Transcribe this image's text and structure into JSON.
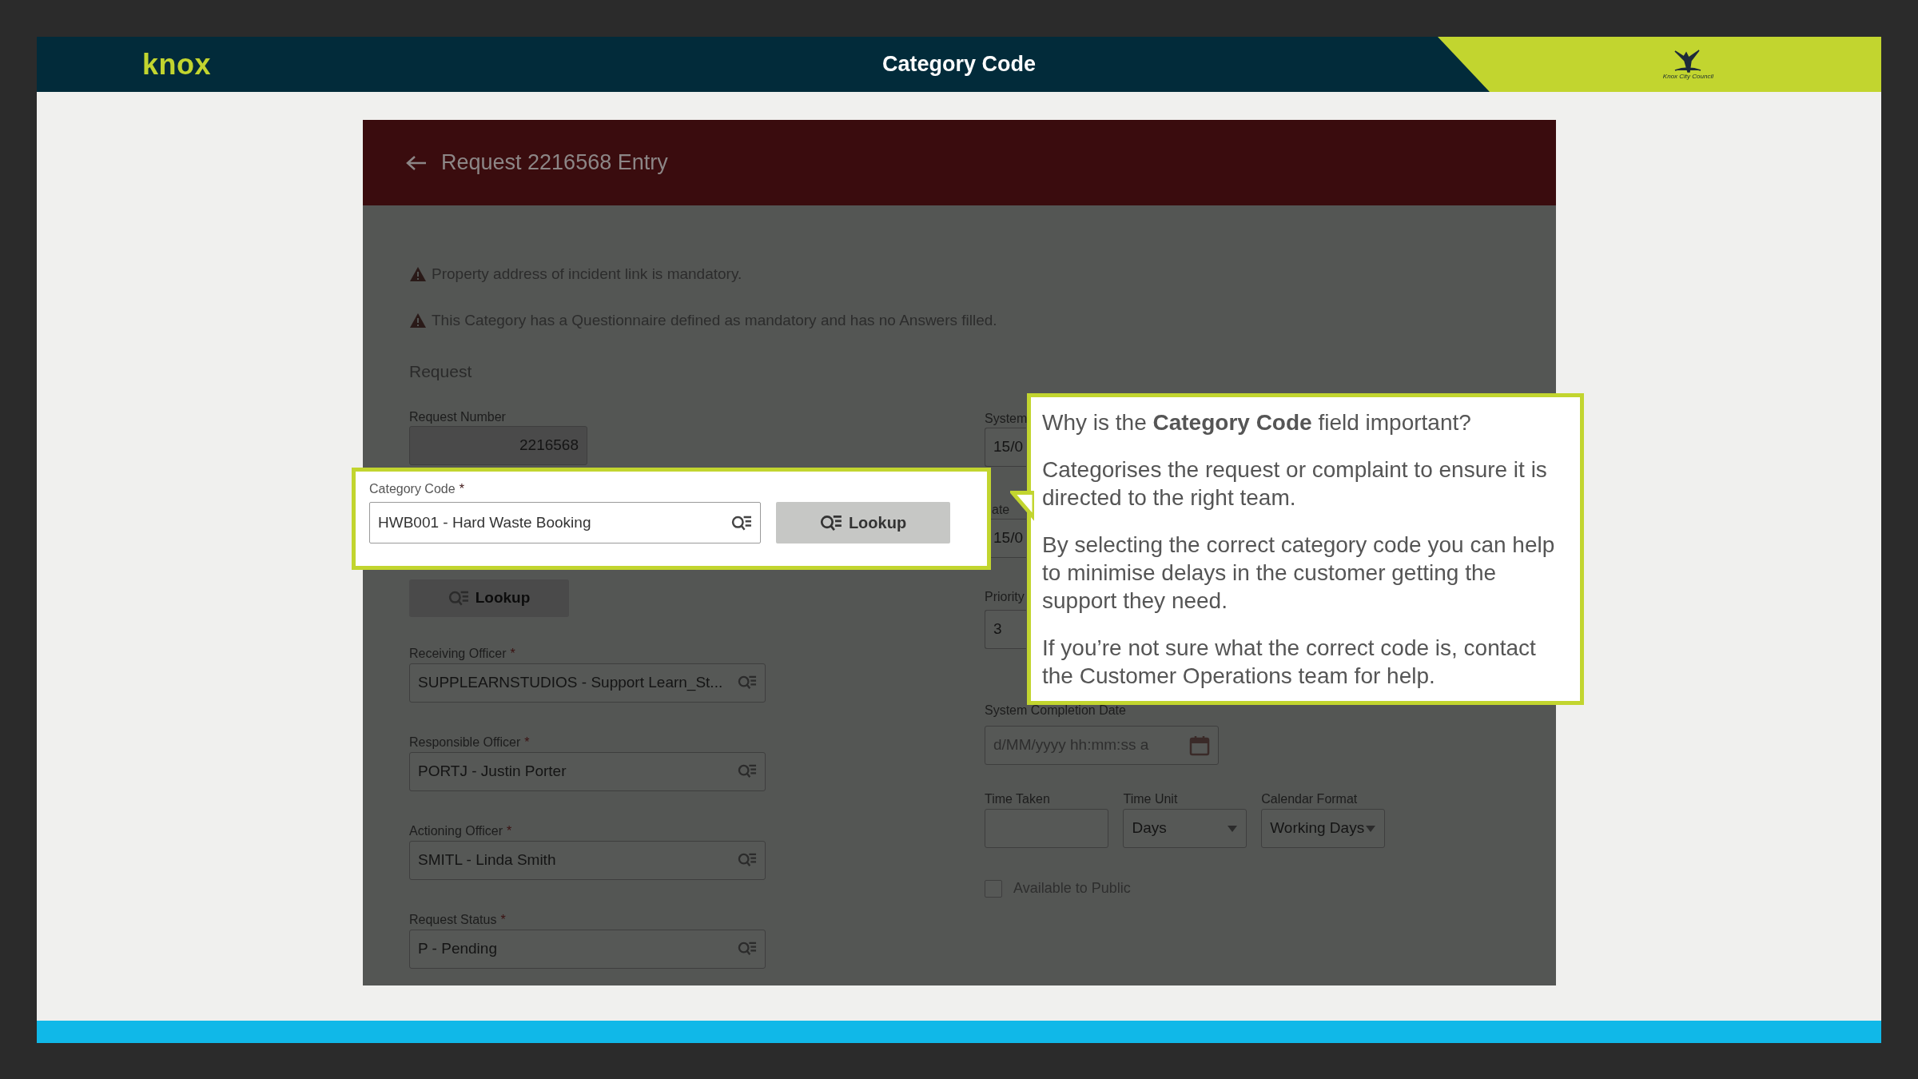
{
  "header": {
    "logo": "knox",
    "title": "Category Code",
    "emblem_caption": "Knox City Council"
  },
  "page": {
    "title": "Request 2216568 Entry"
  },
  "warnings": [
    "Property address of incident link is mandatory.",
    "This Category has a Questionnaire defined as mandatory and has no Answers filled."
  ],
  "section": "Request",
  "required_marker": "*",
  "request_number": {
    "label": "Request Number",
    "value": "2216568"
  },
  "lookup_button": "Lookup",
  "officer_fields": [
    {
      "label": "Receiving Officer",
      "required": true,
      "value": "SUPPLEARNSTUDIOS - Support Learn_St..."
    },
    {
      "label": "Responsible Officer",
      "required": true,
      "value": "PORTJ - Justin Porter"
    },
    {
      "label": "Actioning Officer",
      "required": true,
      "value": "SMITL - Linda Smith"
    },
    {
      "label": "Request Status",
      "required": true,
      "value": "P - Pending"
    }
  ],
  "right_fields": [
    {
      "label": "System",
      "value": "15/0"
    },
    {
      "label": "ate",
      "value": "15/0"
    },
    {
      "label": "Priority",
      "value": "3"
    }
  ],
  "completion_date": {
    "label": "System Completion Date",
    "placeholder": "d/MM/yyyy hh:mm:ss a"
  },
  "time_row": [
    {
      "kind": "text",
      "label": "Time Taken"
    },
    {
      "kind": "select",
      "label": "Time Unit",
      "value": "Days"
    },
    {
      "kind": "select",
      "label": "Calendar Format",
      "value": "Working Days"
    }
  ],
  "public_checkbox": {
    "label": "Available to Public",
    "checked": false
  },
  "highlight": {
    "label": "Category Code",
    "required": true,
    "value": "HWB001 - Hard Waste Booking",
    "button": "Lookup"
  },
  "callout": {
    "heading": "Why is the **Category Code** field important?",
    "paragraphs": [
      "Categorises the request or complaint to ensure it is directed to the right team.",
      "By selecting the correct category code you can help to minimise delays in the customer getting the support they need.",
      "If you’re not sure what the correct code is, contact the Customer Operations team for help."
    ]
  }
}
